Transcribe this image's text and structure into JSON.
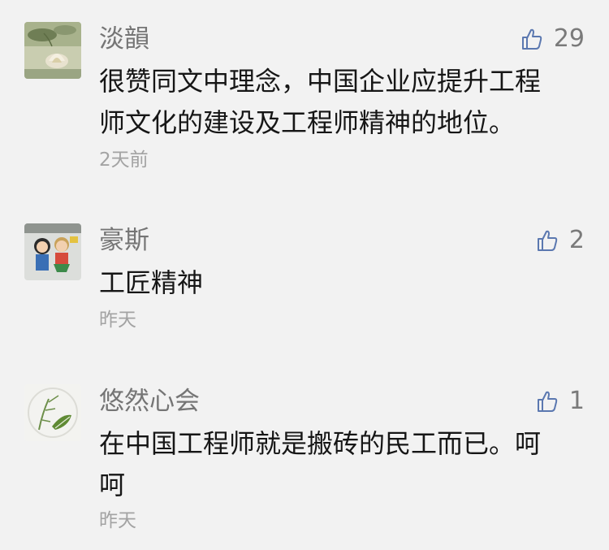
{
  "comments": [
    {
      "author": "淡韻",
      "likes": "29",
      "lines": [
        "很赞同文中理念，中国企业应提升工程",
        "师文化的建设及工程师精神的地位。"
      ],
      "time": "2天前",
      "avatar_icon": "lotus-avatar"
    },
    {
      "author": "豪斯",
      "likes": "2",
      "lines": [
        "工匠精神"
      ],
      "time": "昨天",
      "avatar_icon": "cartoon-kids-avatar"
    },
    {
      "author": "悠然心会",
      "likes": "1",
      "lines": [
        "在中国工程师就是搬砖的民工而已。呵",
        "呵"
      ],
      "time": "昨天",
      "avatar_icon": "bamboo-leaf-avatar"
    }
  ],
  "colors": {
    "background": "#f2f2f2",
    "author": "#757575",
    "body_text": "#161616",
    "time": "#a3a3a3",
    "like_icon": "#5b78b0"
  }
}
